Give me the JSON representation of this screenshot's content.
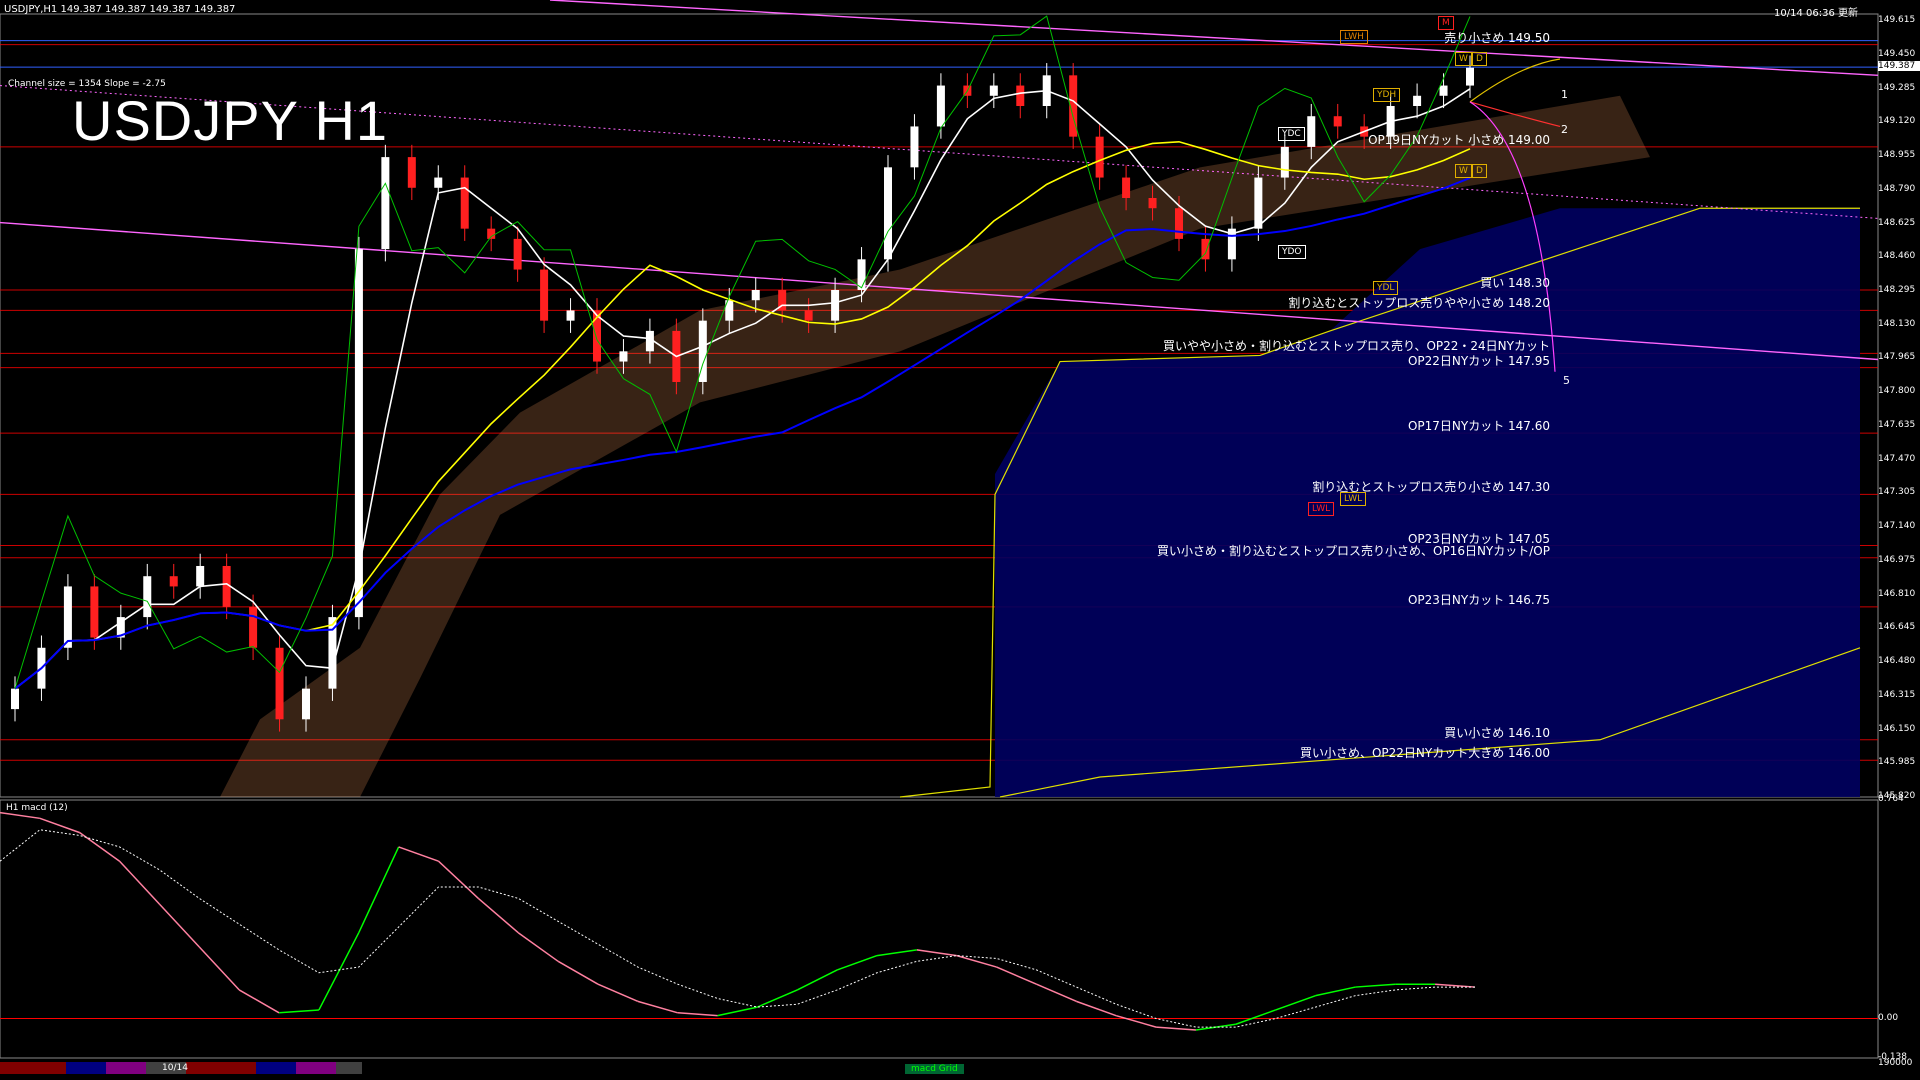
{
  "header": {
    "symbol_info": "USDJPY,H1  149.387 149.387 149.387 149.387",
    "timestamp": "10/14 06:36 更新"
  },
  "chart_title": "USDJPY H1",
  "channel_info": "Channel size = 1354  Slope = -2.75",
  "macd_label": "H1  macd (12)",
  "price_axis": {
    "labels": [
      "149.615",
      "149.450",
      "149.285",
      "149.120",
      "148.955",
      "148.790",
      "148.625",
      "148.460",
      "148.295",
      "148.130",
      "147.965",
      "147.800",
      "147.635",
      "147.470",
      "147.305",
      "147.140",
      "146.975",
      "146.810",
      "146.645",
      "146.480",
      "146.315",
      "146.150",
      "145.985",
      "145.820"
    ],
    "current_price": "149.387"
  },
  "macd_axis": {
    "labels": [
      "0.764",
      "0.00",
      "-0.138",
      "190000"
    ]
  },
  "annotations": [
    {
      "text": "売り小さめ 149.50",
      "price": 149.5
    },
    {
      "text": "OP19日NYカット  小さめ 149.00",
      "price": 149.0
    },
    {
      "text": "買い 148.30",
      "price": 148.3
    },
    {
      "text": "割り込むとストップロス売りやや小さめ 148.20",
      "price": 148.2
    },
    {
      "text": "買いやや小さめ・割り込むとストップロス売り、OP22・24日NYカット",
      "price": 147.99
    },
    {
      "text": "OP22日NYカット 147.95",
      "price": 147.92
    },
    {
      "text": "OP17日NYカット 147.60",
      "price": 147.6
    },
    {
      "text": "割り込むとストップロス売り小さめ 147.30",
      "price": 147.3
    },
    {
      "text": "OP23日NYカット 147.05",
      "price": 147.05
    },
    {
      "text": "買い小さめ・割り込むとストップロス売り小さめ、OP16日NYカット/OP",
      "price": 146.99
    },
    {
      "text": "OP23日NYカット 146.75",
      "price": 146.75
    },
    {
      "text": "買い小さめ 146.10",
      "price": 146.1
    },
    {
      "text": "買い小さめ、OP22日NYカット大きめ 146.00",
      "price": 146.0
    }
  ],
  "tags": [
    {
      "text": "LWH",
      "color": "#e08000"
    },
    {
      "text": "M",
      "color": "#ff2020"
    },
    {
      "text": "W",
      "color": "#e0b000"
    },
    {
      "text": "D",
      "color": "#e0b000"
    },
    {
      "text": "YDH",
      "color": "#e0b000"
    },
    {
      "text": "YDC",
      "color": "#ffffff"
    },
    {
      "text": "YDO",
      "color": "#ffffff"
    },
    {
      "text": "YDL",
      "color": "#e0b000"
    },
    {
      "text": "LWL",
      "color": "#e0b000"
    },
    {
      "text": "LWL",
      "color": "#ff2020"
    },
    {
      "text": "W",
      "color": "#e0b000"
    },
    {
      "text": "D",
      "color": "#e0b000"
    }
  ],
  "projection_labels": [
    "1",
    "2",
    "5"
  ],
  "bottom_bar": {
    "date": "10/14",
    "tab": "macd Grid"
  },
  "colors": {
    "background": "#000000",
    "candle_up": "#ffffff",
    "candle_down": "#ff2020",
    "sma_short": "#ffffff",
    "sma_mid": "#ffff00",
    "sma_long": "#0000ff",
    "chikou": "#00c000",
    "channel": "#ff66ff",
    "support_lines": "#ff0000",
    "cloud": "#ffc080",
    "macd_line": "#00ff00",
    "macd_down": "#ff80a0",
    "signal": "#ffffff"
  },
  "chart_data": {
    "type": "candlestick",
    "symbol": "USDJPY",
    "timeframe": "H1",
    "ylim": [
      145.82,
      149.65
    ],
    "closes": [
      146.35,
      146.55,
      146.85,
      146.6,
      146.7,
      146.9,
      146.85,
      146.95,
      146.75,
      146.55,
      146.2,
      146.35,
      146.7,
      148.5,
      148.95,
      148.8,
      148.85,
      148.6,
      148.55,
      148.4,
      148.15,
      148.2,
      147.95,
      148.0,
      148.1,
      147.85,
      148.15,
      148.25,
      148.3,
      148.2,
      148.15,
      148.3,
      148.45,
      148.9,
      149.1,
      149.3,
      149.25,
      149.3,
      149.2,
      149.35,
      149.05,
      148.85,
      148.75,
      148.7,
      148.55,
      148.45,
      148.6,
      148.85,
      149.0,
      149.15,
      149.1,
      149.05,
      149.2,
      149.25,
      149.3,
      149.387
    ],
    "support_levels": [
      149.5,
      149.0,
      148.3,
      148.2,
      147.99,
      147.92,
      147.6,
      147.3,
      147.05,
      146.99,
      146.75,
      146.1,
      146.0
    ],
    "macd": [
      0.72,
      0.7,
      0.65,
      0.55,
      0.4,
      0.25,
      0.1,
      0.02,
      0.03,
      0.3,
      0.6,
      0.55,
      0.42,
      0.3,
      0.2,
      0.12,
      0.06,
      0.02,
      0.01,
      0.04,
      0.1,
      0.17,
      0.22,
      0.24,
      0.22,
      0.18,
      0.12,
      0.06,
      0.01,
      -0.03,
      -0.04,
      -0.02,
      0.03,
      0.08,
      0.11,
      0.12,
      0.12,
      0.11
    ],
    "macd_signal": [
      0.55,
      0.66,
      0.64,
      0.6,
      0.52,
      0.42,
      0.33,
      0.24,
      0.16,
      0.18,
      0.32,
      0.46,
      0.46,
      0.42,
      0.34,
      0.26,
      0.18,
      0.12,
      0.07,
      0.04,
      0.05,
      0.1,
      0.16,
      0.2,
      0.22,
      0.21,
      0.17,
      0.11,
      0.05,
      0.0,
      -0.03,
      -0.03,
      0.0,
      0.04,
      0.08,
      0.1,
      0.11,
      0.11
    ],
    "macd_ylim": [
      -0.138,
      0.764
    ]
  }
}
